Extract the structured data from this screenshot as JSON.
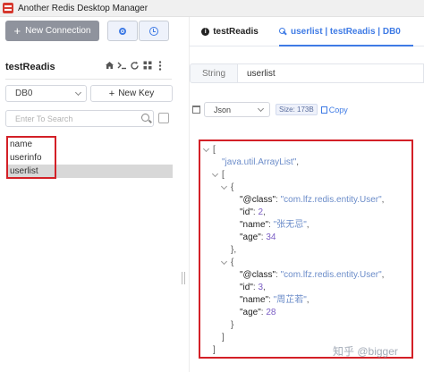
{
  "window": {
    "title": "Another Redis Desktop Manager"
  },
  "toolbar": {
    "new_connection_label": "New Connection",
    "status_icon": "record-icon",
    "history_icon": "clock-icon"
  },
  "connection": {
    "name": "testReadis",
    "tools": [
      "home-icon",
      "terminal-icon",
      "refresh-icon",
      "grid-icon",
      "more-icon"
    ]
  },
  "db_select": {
    "selected": "DB0"
  },
  "new_key_label": "New Key",
  "search": {
    "placeholder": "Enter To Search",
    "value": ""
  },
  "keys": [
    {
      "name": "name",
      "selected": false
    },
    {
      "name": "userinfo",
      "selected": false
    },
    {
      "name": "userlist",
      "selected": true
    }
  ],
  "tabs": [
    {
      "label": "testReadis",
      "icon": "info-icon",
      "active": false
    },
    {
      "label": "userlist | testReadis | DB0",
      "icon": "key-icon",
      "active": true
    }
  ],
  "key_detail": {
    "type": "String",
    "key_name": "userlist",
    "format": "Json",
    "size_label": "Size: 173B",
    "copy_label": "Copy"
  },
  "json_lines": [
    {
      "fold": true,
      "tokens": [
        {
          "t": "p",
          "v": "["
        }
      ]
    },
    {
      "fold": false,
      "tokens": [
        {
          "t": "s",
          "v": "\"java.util.ArrayList\""
        },
        {
          "t": "p",
          "v": ","
        }
      ]
    },
    {
      "fold": true,
      "tokens": [
        {
          "t": "p",
          "v": "["
        }
      ]
    },
    {
      "fold": true,
      "tokens": [
        {
          "t": "p",
          "v": "{"
        }
      ]
    },
    {
      "fold": false,
      "tokens": [
        {
          "t": "k",
          "v": "\"@class\""
        },
        {
          "t": "p",
          "v": ": "
        },
        {
          "t": "s",
          "v": "\"com.lfz.redis.entity.User\""
        },
        {
          "t": "p",
          "v": ","
        }
      ]
    },
    {
      "fold": false,
      "tokens": [
        {
          "t": "k",
          "v": "\"id\""
        },
        {
          "t": "p",
          "v": ": "
        },
        {
          "t": "n",
          "v": "2"
        },
        {
          "t": "p",
          "v": ","
        }
      ]
    },
    {
      "fold": false,
      "tokens": [
        {
          "t": "k",
          "v": "\"name\""
        },
        {
          "t": "p",
          "v": ": "
        },
        {
          "t": "s",
          "v": "\"张无忌\""
        },
        {
          "t": "p",
          "v": ","
        }
      ]
    },
    {
      "fold": false,
      "tokens": [
        {
          "t": "k",
          "v": "\"age\""
        },
        {
          "t": "p",
          "v": ": "
        },
        {
          "t": "n",
          "v": "34"
        }
      ]
    },
    {
      "fold": false,
      "tokens": [
        {
          "t": "p",
          "v": "},"
        }
      ]
    },
    {
      "fold": true,
      "tokens": [
        {
          "t": "p",
          "v": "{"
        }
      ]
    },
    {
      "fold": false,
      "tokens": [
        {
          "t": "k",
          "v": "\"@class\""
        },
        {
          "t": "p",
          "v": ": "
        },
        {
          "t": "s",
          "v": "\"com.lfz.redis.entity.User\""
        },
        {
          "t": "p",
          "v": ","
        }
      ]
    },
    {
      "fold": false,
      "tokens": [
        {
          "t": "k",
          "v": "\"id\""
        },
        {
          "t": "p",
          "v": ": "
        },
        {
          "t": "n",
          "v": "3"
        },
        {
          "t": "p",
          "v": ","
        }
      ]
    },
    {
      "fold": false,
      "tokens": [
        {
          "t": "k",
          "v": "\"name\""
        },
        {
          "t": "p",
          "v": ": "
        },
        {
          "t": "s",
          "v": "\"周芷若\""
        },
        {
          "t": "p",
          "v": ","
        }
      ]
    },
    {
      "fold": false,
      "tokens": [
        {
          "t": "k",
          "v": "\"age\""
        },
        {
          "t": "p",
          "v": ": "
        },
        {
          "t": "n",
          "v": "28"
        }
      ]
    },
    {
      "fold": false,
      "tokens": [
        {
          "t": "p",
          "v": "}"
        }
      ]
    },
    {
      "fold": false,
      "tokens": [
        {
          "t": "p",
          "v": "]"
        }
      ]
    },
    {
      "fold": false,
      "tokens": [
        {
          "t": "p",
          "v": "]"
        }
      ]
    }
  ],
  "watermark": "知乎 @bigger"
}
